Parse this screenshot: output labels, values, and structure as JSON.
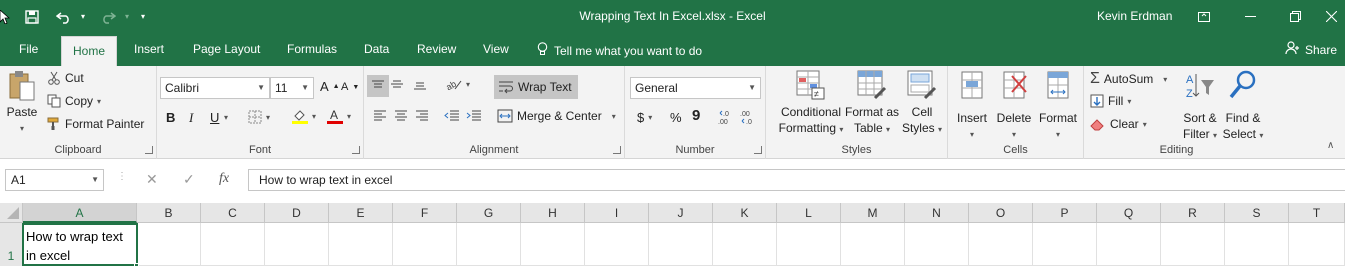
{
  "window": {
    "title": "Wrapping Text In Excel.xlsx - Excel",
    "user": "Kevin Erdman"
  },
  "tabs": {
    "file": "File",
    "home": "Home",
    "insert": "Insert",
    "page_layout": "Page Layout",
    "formulas": "Formulas",
    "data": "Data",
    "review": "Review",
    "view": "View",
    "tell_me": "Tell me what you want to do",
    "share": "Share"
  },
  "clipboard": {
    "paste": "Paste",
    "cut": "Cut",
    "copy": "Copy",
    "format_painter": "Format Painter",
    "label": "Clipboard"
  },
  "font": {
    "name": "Calibri",
    "size": "11",
    "bold": "B",
    "italic": "I",
    "underline": "U",
    "label": "Font"
  },
  "alignment": {
    "wrap_text": "Wrap Text",
    "merge_center": "Merge & Center",
    "label": "Alignment"
  },
  "number": {
    "format": "General",
    "currency": "$",
    "percent": "%",
    "comma": "9",
    "label": "Number"
  },
  "styles": {
    "conditional_1": "Conditional",
    "conditional_2": "Formatting",
    "format_table_1": "Format as",
    "format_table_2": "Table",
    "cell_styles_1": "Cell",
    "cell_styles_2": "Styles",
    "label": "Styles"
  },
  "cells": {
    "insert": "Insert",
    "delete": "Delete",
    "format": "Format",
    "label": "Cells"
  },
  "editing": {
    "autosum": "AutoSum",
    "fill": "Fill",
    "clear": "Clear",
    "sort_1": "Sort &",
    "sort_2": "Filter",
    "find_1": "Find &",
    "find_2": "Select",
    "label": "Editing"
  },
  "formula_bar": {
    "name_box": "A1",
    "fx": "fx",
    "content": "How to wrap text in excel"
  },
  "grid": {
    "columns": [
      "A",
      "B",
      "C",
      "D",
      "E",
      "F",
      "G",
      "H",
      "I",
      "J",
      "K",
      "L",
      "M",
      "N",
      "O",
      "P",
      "Q",
      "R",
      "S",
      "T"
    ],
    "rows": [
      "1"
    ],
    "a1_line1": "How to wrap text",
    "a1_line2": "in excel"
  },
  "colors": {
    "brand": "#217346",
    "ribbon": "#f3f3f3"
  }
}
